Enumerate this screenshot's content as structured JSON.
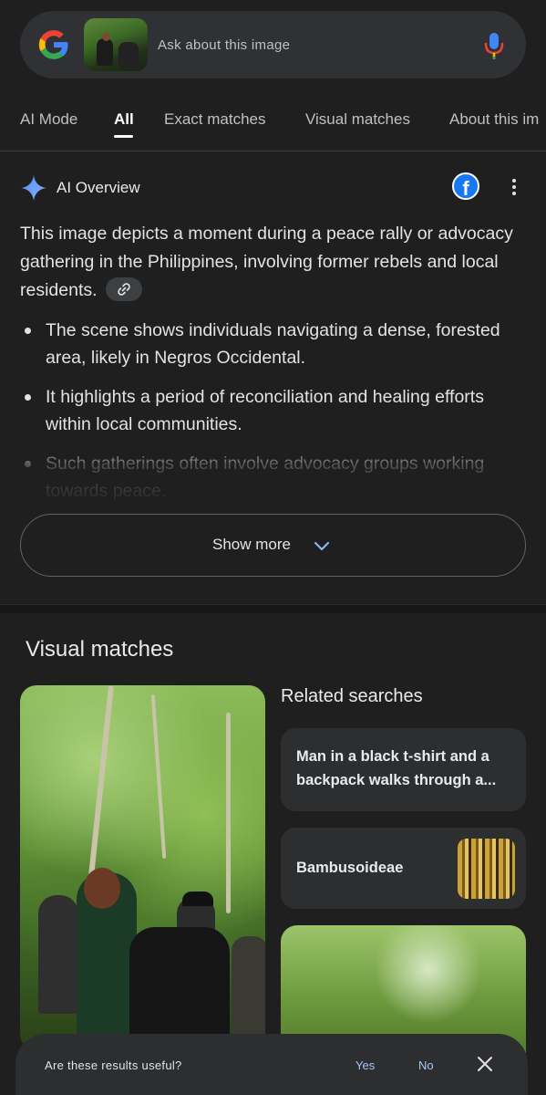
{
  "search": {
    "placeholder": "Ask about this image"
  },
  "tabs": [
    {
      "label": "AI Mode"
    },
    {
      "label": "All",
      "active": true
    },
    {
      "label": "Exact matches"
    },
    {
      "label": "Visual matches"
    },
    {
      "label": "About this im"
    }
  ],
  "ai_overview": {
    "title": "AI Overview",
    "summary": "This image depicts a moment during a peace rally or advocacy gathering in the Philippines, involving former rebels and local residents.",
    "bullets": [
      "The scene shows individuals navigating a dense, forested area, likely in Negros Occidental.",
      "It highlights a period of reconciliation and healing efforts within local communities.",
      "Such gatherings often involve advocacy groups working towards peace."
    ],
    "show_more": "Show more"
  },
  "visual_matches": {
    "title": "Visual matches",
    "related_title": "Related searches",
    "related": [
      {
        "label": "Man in a black t-shirt and a backpack walks through a..."
      },
      {
        "label": "Bambusoideae"
      }
    ]
  },
  "feedback": {
    "question": "Are these results useful?",
    "yes": "Yes",
    "no": "No"
  },
  "colors": {
    "background": "#1f1f1f",
    "surface": "#303134",
    "card": "#2d2e30",
    "link_blue": "#a8c7fa",
    "facebook": "#1877f2"
  }
}
